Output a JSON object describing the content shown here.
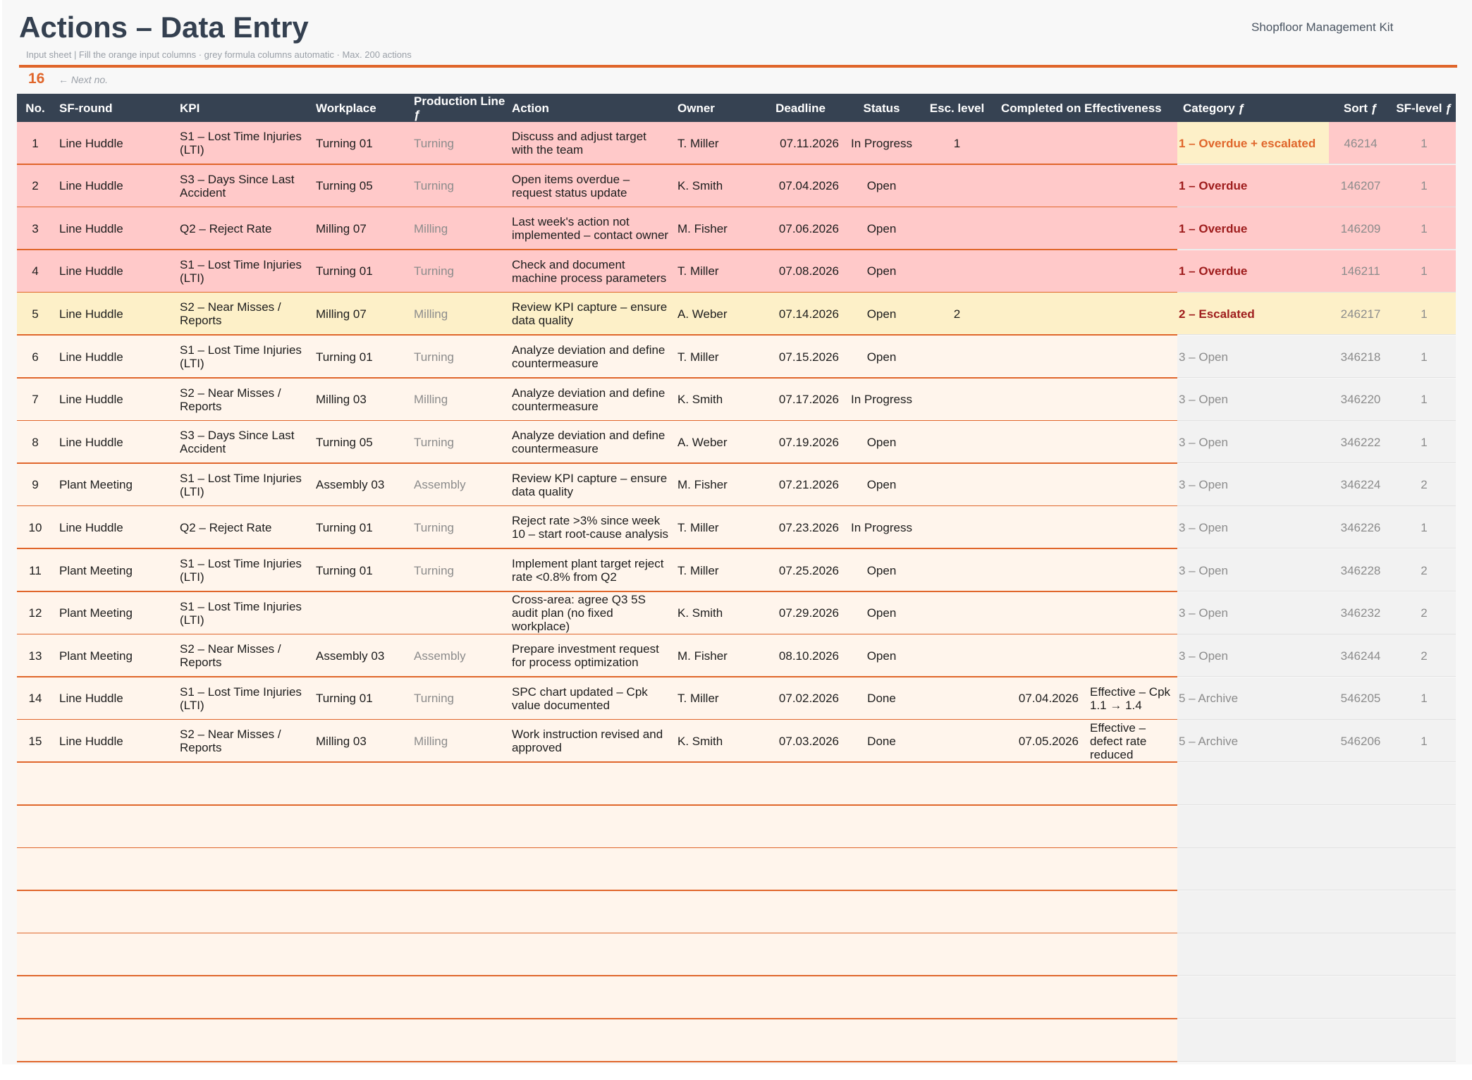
{
  "header": {
    "title": "Actions – Data Entry",
    "brand": "Shopfloor Management Kit",
    "subtitle": "Input sheet  |  Fill the orange input columns  ·  grey formula columns automatic  ·  Max. 200 actions",
    "next_number": "16",
    "next_label": "← Next no."
  },
  "colors": {
    "accent": "#e0662b",
    "header_bg": "#364252",
    "overdue_row": "#ffc9c9",
    "escalated_row": "#fdf0c8",
    "input_row": "#fff5ec",
    "auto_col": "#f2f2f2",
    "overdue_text": "#9e1c1c",
    "overdue_escalated_text": "#e0662b",
    "muted_text": "#8c8c8c"
  },
  "table": {
    "columns": [
      "No.",
      "SF-round",
      "KPI",
      "Workplace",
      "Production Line ƒ",
      "Action",
      "Owner",
      "Deadline",
      "Status",
      "Esc. level",
      "Completed on",
      "Effectiveness",
      "Category ƒ",
      "Sort ƒ",
      "SF-level ƒ"
    ],
    "rows": [
      {
        "no": "1",
        "round": "Line Huddle",
        "kpi": "S1 – Lost Time Injuries (LTI)",
        "workplace": "Turning 01",
        "line": "Turning",
        "action": "Discuss and adjust target with the team",
        "owner": "T. Miller",
        "deadline": "07.11.2026",
        "status": "In Progress",
        "esc": "1",
        "completed": "",
        "effectiveness": "",
        "category": "1 – Overdue + escalated",
        "sort": "46214",
        "level": "1",
        "kind": "overdue-esc"
      },
      {
        "no": "2",
        "round": "Line Huddle",
        "kpi": "S3 – Days Since Last Accident",
        "workplace": "Turning 05",
        "line": "Turning",
        "action": "Open items overdue – request status update",
        "owner": "K. Smith",
        "deadline": "07.04.2026",
        "status": "Open",
        "esc": "",
        "completed": "",
        "effectiveness": "",
        "category": "1 – Overdue",
        "sort": "146207",
        "level": "1",
        "kind": "overdue"
      },
      {
        "no": "3",
        "round": "Line Huddle",
        "kpi": "Q2 – Reject Rate",
        "workplace": "Milling 07",
        "line": "Milling",
        "action": "Last week's action not implemented – contact owner",
        "owner": "M. Fisher",
        "deadline": "07.06.2026",
        "status": "Open",
        "esc": "",
        "completed": "",
        "effectiveness": "",
        "category": "1 – Overdue",
        "sort": "146209",
        "level": "1",
        "kind": "overdue"
      },
      {
        "no": "4",
        "round": "Line Huddle",
        "kpi": "S1 – Lost Time Injuries (LTI)",
        "workplace": "Turning 01",
        "line": "Turning",
        "action": "Check and document machine process parameters",
        "owner": "T. Miller",
        "deadline": "07.08.2026",
        "status": "Open",
        "esc": "",
        "completed": "",
        "effectiveness": "",
        "category": "1 – Overdue",
        "sort": "146211",
        "level": "1",
        "kind": "overdue"
      },
      {
        "no": "5",
        "round": "Line Huddle",
        "kpi": "S2 – Near Misses / Reports",
        "workplace": "Milling 07",
        "line": "Milling",
        "action": "Review KPI capture – ensure data quality",
        "owner": "A. Weber",
        "deadline": "07.14.2026",
        "status": "Open",
        "esc": "2",
        "completed": "",
        "effectiveness": "",
        "category": "2 – Escalated",
        "sort": "246217",
        "level": "1",
        "kind": "escalated"
      },
      {
        "no": "6",
        "round": "Line Huddle",
        "kpi": "S1 – Lost Time Injuries (LTI)",
        "workplace": "Turning 01",
        "line": "Turning",
        "action": "Analyze deviation and define countermeasure",
        "owner": "T. Miller",
        "deadline": "07.15.2026",
        "status": "Open",
        "esc": "",
        "completed": "",
        "effectiveness": "",
        "category": "3 – Open",
        "sort": "346218",
        "level": "1",
        "kind": "open"
      },
      {
        "no": "7",
        "round": "Line Huddle",
        "kpi": "S2 – Near Misses / Reports",
        "workplace": "Milling 03",
        "line": "Milling",
        "action": "Analyze deviation and define countermeasure",
        "owner": "K. Smith",
        "deadline": "07.17.2026",
        "status": "In Progress",
        "esc": "",
        "completed": "",
        "effectiveness": "",
        "category": "3 – Open",
        "sort": "346220",
        "level": "1",
        "kind": "open"
      },
      {
        "no": "8",
        "round": "Line Huddle",
        "kpi": "S3 – Days Since Last Accident",
        "workplace": "Turning 05",
        "line": "Turning",
        "action": "Analyze deviation and define countermeasure",
        "owner": "A. Weber",
        "deadline": "07.19.2026",
        "status": "Open",
        "esc": "",
        "completed": "",
        "effectiveness": "",
        "category": "3 – Open",
        "sort": "346222",
        "level": "1",
        "kind": "open"
      },
      {
        "no": "9",
        "round": "Plant Meeting",
        "kpi": "S1 – Lost Time Injuries (LTI)",
        "workplace": "Assembly 03",
        "line": "Assembly",
        "action": "Review KPI capture – ensure data quality",
        "owner": "M. Fisher",
        "deadline": "07.21.2026",
        "status": "Open",
        "esc": "",
        "completed": "",
        "effectiveness": "",
        "category": "3 – Open",
        "sort": "346224",
        "level": "2",
        "kind": "open"
      },
      {
        "no": "10",
        "round": "Line Huddle",
        "kpi": "Q2 – Reject Rate",
        "workplace": "Turning 01",
        "line": "Turning",
        "action": "Reject rate >3% since week 10 – start root-cause analysis",
        "owner": "T. Miller",
        "deadline": "07.23.2026",
        "status": "In Progress",
        "esc": "",
        "completed": "",
        "effectiveness": "",
        "category": "3 – Open",
        "sort": "346226",
        "level": "1",
        "kind": "open"
      },
      {
        "no": "11",
        "round": "Plant Meeting",
        "kpi": "S1 – Lost Time Injuries (LTI)",
        "workplace": "Turning 01",
        "line": "Turning",
        "action": "Implement plant target reject rate <0.8% from Q2",
        "owner": "T. Miller",
        "deadline": "07.25.2026",
        "status": "Open",
        "esc": "",
        "completed": "",
        "effectiveness": "",
        "category": "3 – Open",
        "sort": "346228",
        "level": "2",
        "kind": "open"
      },
      {
        "no": "12",
        "round": "Plant Meeting",
        "kpi": "S1 – Lost Time Injuries (LTI)",
        "workplace": "",
        "line": "",
        "action": "Cross-area: agree Q3 5S audit plan (no fixed workplace)",
        "owner": "K. Smith",
        "deadline": "07.29.2026",
        "status": "Open",
        "esc": "",
        "completed": "",
        "effectiveness": "",
        "category": "3 – Open",
        "sort": "346232",
        "level": "2",
        "kind": "open"
      },
      {
        "no": "13",
        "round": "Plant Meeting",
        "kpi": "S2 – Near Misses / Reports",
        "workplace": "Assembly 03",
        "line": "Assembly",
        "action": "Prepare investment request for process optimization",
        "owner": "M. Fisher",
        "deadline": "08.10.2026",
        "status": "Open",
        "esc": "",
        "completed": "",
        "effectiveness": "",
        "category": "3 – Open",
        "sort": "346244",
        "level": "2",
        "kind": "open"
      },
      {
        "no": "14",
        "round": "Line Huddle",
        "kpi": "S1 – Lost Time Injuries (LTI)",
        "workplace": "Turning 01",
        "line": "Turning",
        "action": "SPC chart updated – Cpk value documented",
        "owner": "T. Miller",
        "deadline": "07.02.2026",
        "status": "Done",
        "esc": "",
        "completed": "07.04.2026",
        "effectiveness": "Effective – Cpk 1.1 → 1.4",
        "category": "5 – Archive",
        "sort": "546205",
        "level": "1",
        "kind": "archive"
      },
      {
        "no": "15",
        "round": "Line Huddle",
        "kpi": "S2 – Near Misses / Reports",
        "workplace": "Milling 03",
        "line": "Milling",
        "action": "Work instruction revised and approved",
        "owner": "K. Smith",
        "deadline": "07.03.2026",
        "status": "Done",
        "esc": "",
        "completed": "07.05.2026",
        "effectiveness": "Effective – defect rate reduced",
        "category": "5 – Archive",
        "sort": "546206",
        "level": "1",
        "kind": "archive"
      }
    ],
    "empty_rows": 7
  }
}
